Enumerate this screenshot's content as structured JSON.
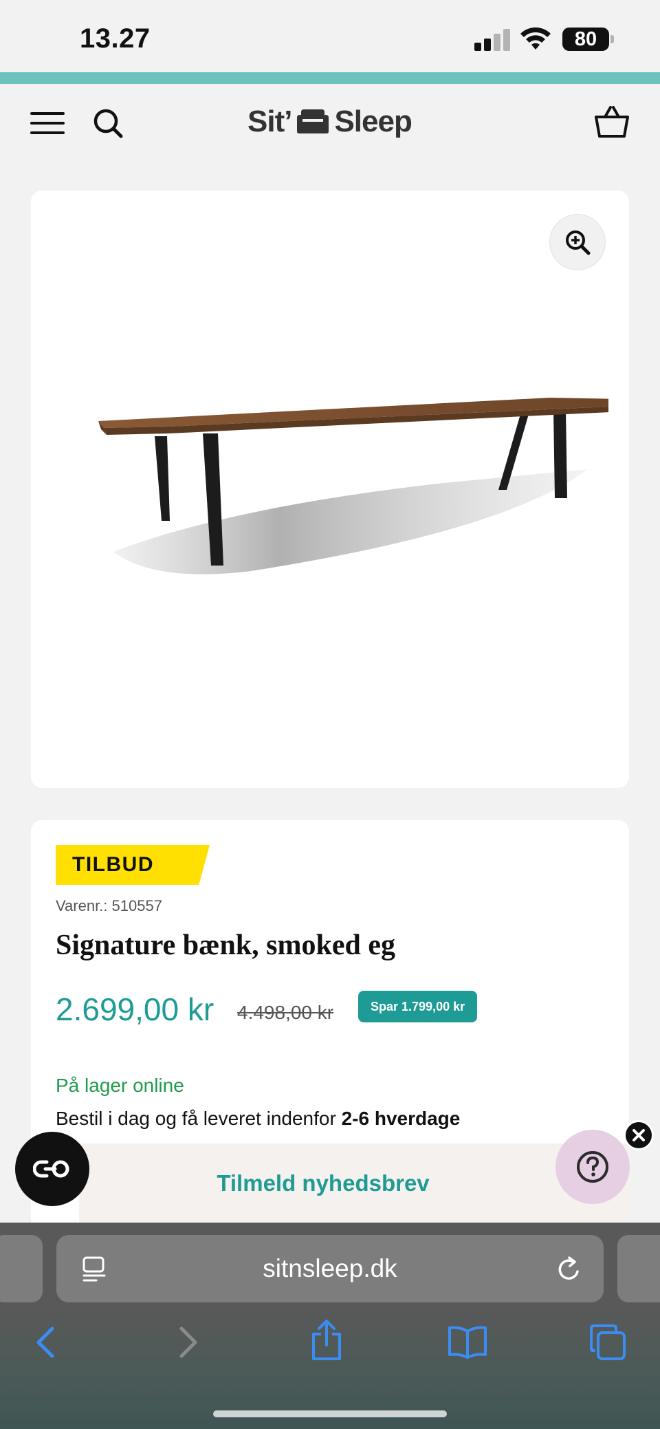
{
  "status_bar": {
    "time": "13.27",
    "battery_level": "80"
  },
  "header": {
    "logo_left": "Sit’",
    "logo_right": "Sleep",
    "accent_color": "#6cc3bd"
  },
  "product": {
    "badge": "TILBUD",
    "sku": "Varenr.: 510557",
    "title": "Signature bænk, smoked eg",
    "price": "2.699,00 kr",
    "old_price": "4.498,00 kr",
    "savings": "Spar 1.799,00 kr",
    "stock_status": "På lager online",
    "delivery_text": "Bestil i dag og få leveret indenfor",
    "delivery_days": "2-6 hverdage",
    "price_color": "#1e9b94",
    "stock_color": "#1f9a4e"
  },
  "newsletter": {
    "label": "Tilmeld nyhedsbrev"
  },
  "browser": {
    "url": "sitnsleep.dk"
  },
  "icons": [
    "menu-icon",
    "search-icon",
    "sofa-icon",
    "cart-icon",
    "zoom-in-icon",
    "accessibility-icon",
    "help-icon",
    "close-icon",
    "reader-icon",
    "reload-icon",
    "back-icon",
    "forward-icon",
    "share-icon",
    "bookmarks-icon",
    "tabs-icon"
  ]
}
